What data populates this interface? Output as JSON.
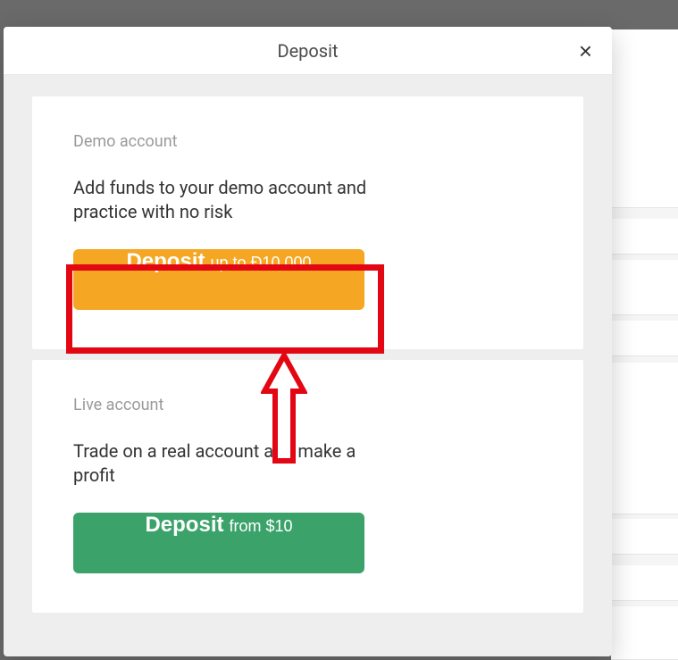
{
  "modal": {
    "title": "Deposit",
    "close": "×"
  },
  "demo": {
    "label": "Demo account",
    "description": "Add funds to your demo account and practice with no risk",
    "button": {
      "main": "Deposit",
      "sub": "up to Đ10,000"
    }
  },
  "live": {
    "label": "Live account",
    "description": "Trade on a real account and make a profit",
    "button": {
      "main": "Deposit",
      "sub": "from $10"
    }
  },
  "annotation": {
    "highlight_color": "#e30613"
  }
}
